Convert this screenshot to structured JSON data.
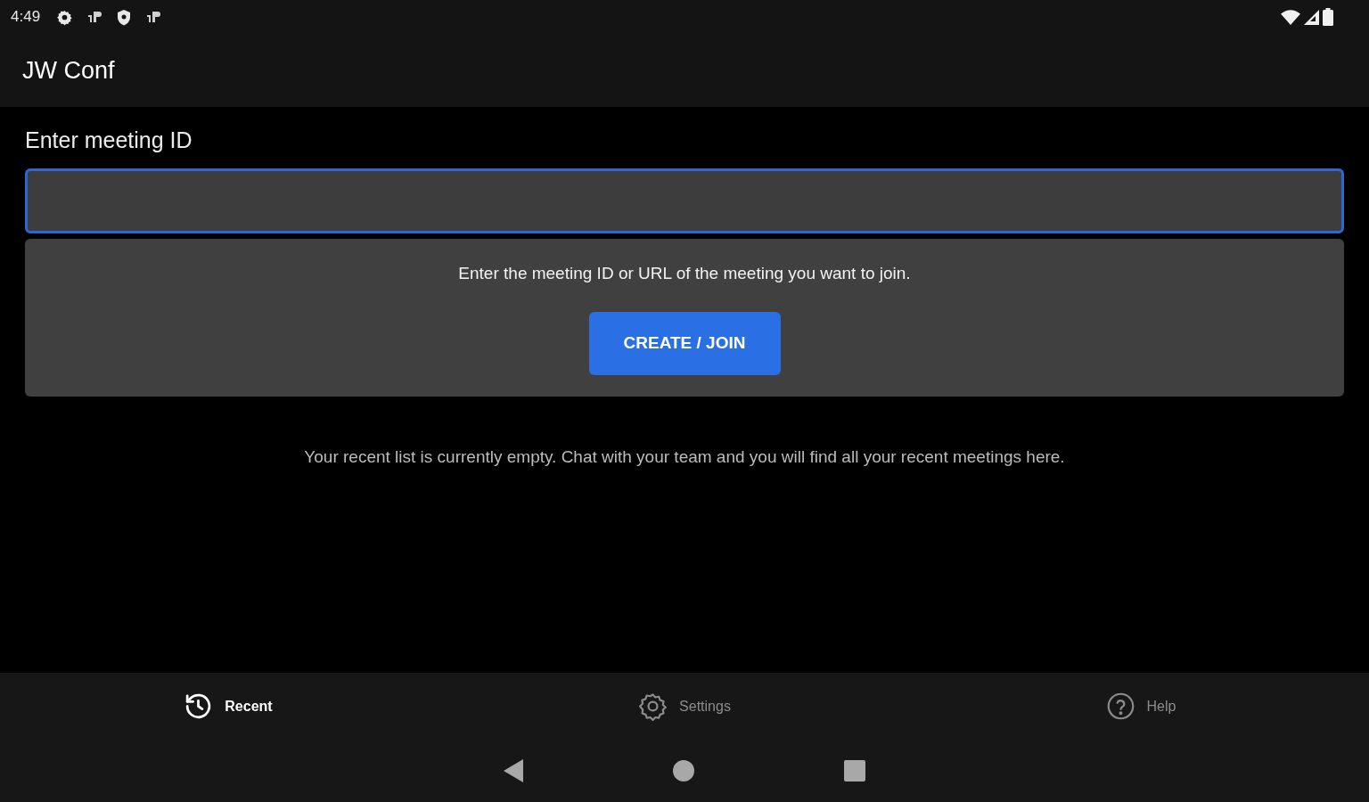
{
  "status_bar": {
    "time": "4:49"
  },
  "app_bar": {
    "title": "JW Conf"
  },
  "meeting": {
    "label": "Enter meeting ID",
    "input": {
      "focused": true
    },
    "hint": "Enter the meeting ID or URL of the meeting you want to join.",
    "button": "CREATE / JOIN"
  },
  "empty_message": "Your recent list is currently empty. Chat with your team and you will find all your recent meetings here.",
  "bottom_nav": [
    {
      "kind": "history",
      "label": "Recent",
      "selected": true
    },
    {
      "kind": "settings",
      "label": "Settings",
      "selected": false
    },
    {
      "kind": "help",
      "label": "Help",
      "selected": false
    }
  ]
}
